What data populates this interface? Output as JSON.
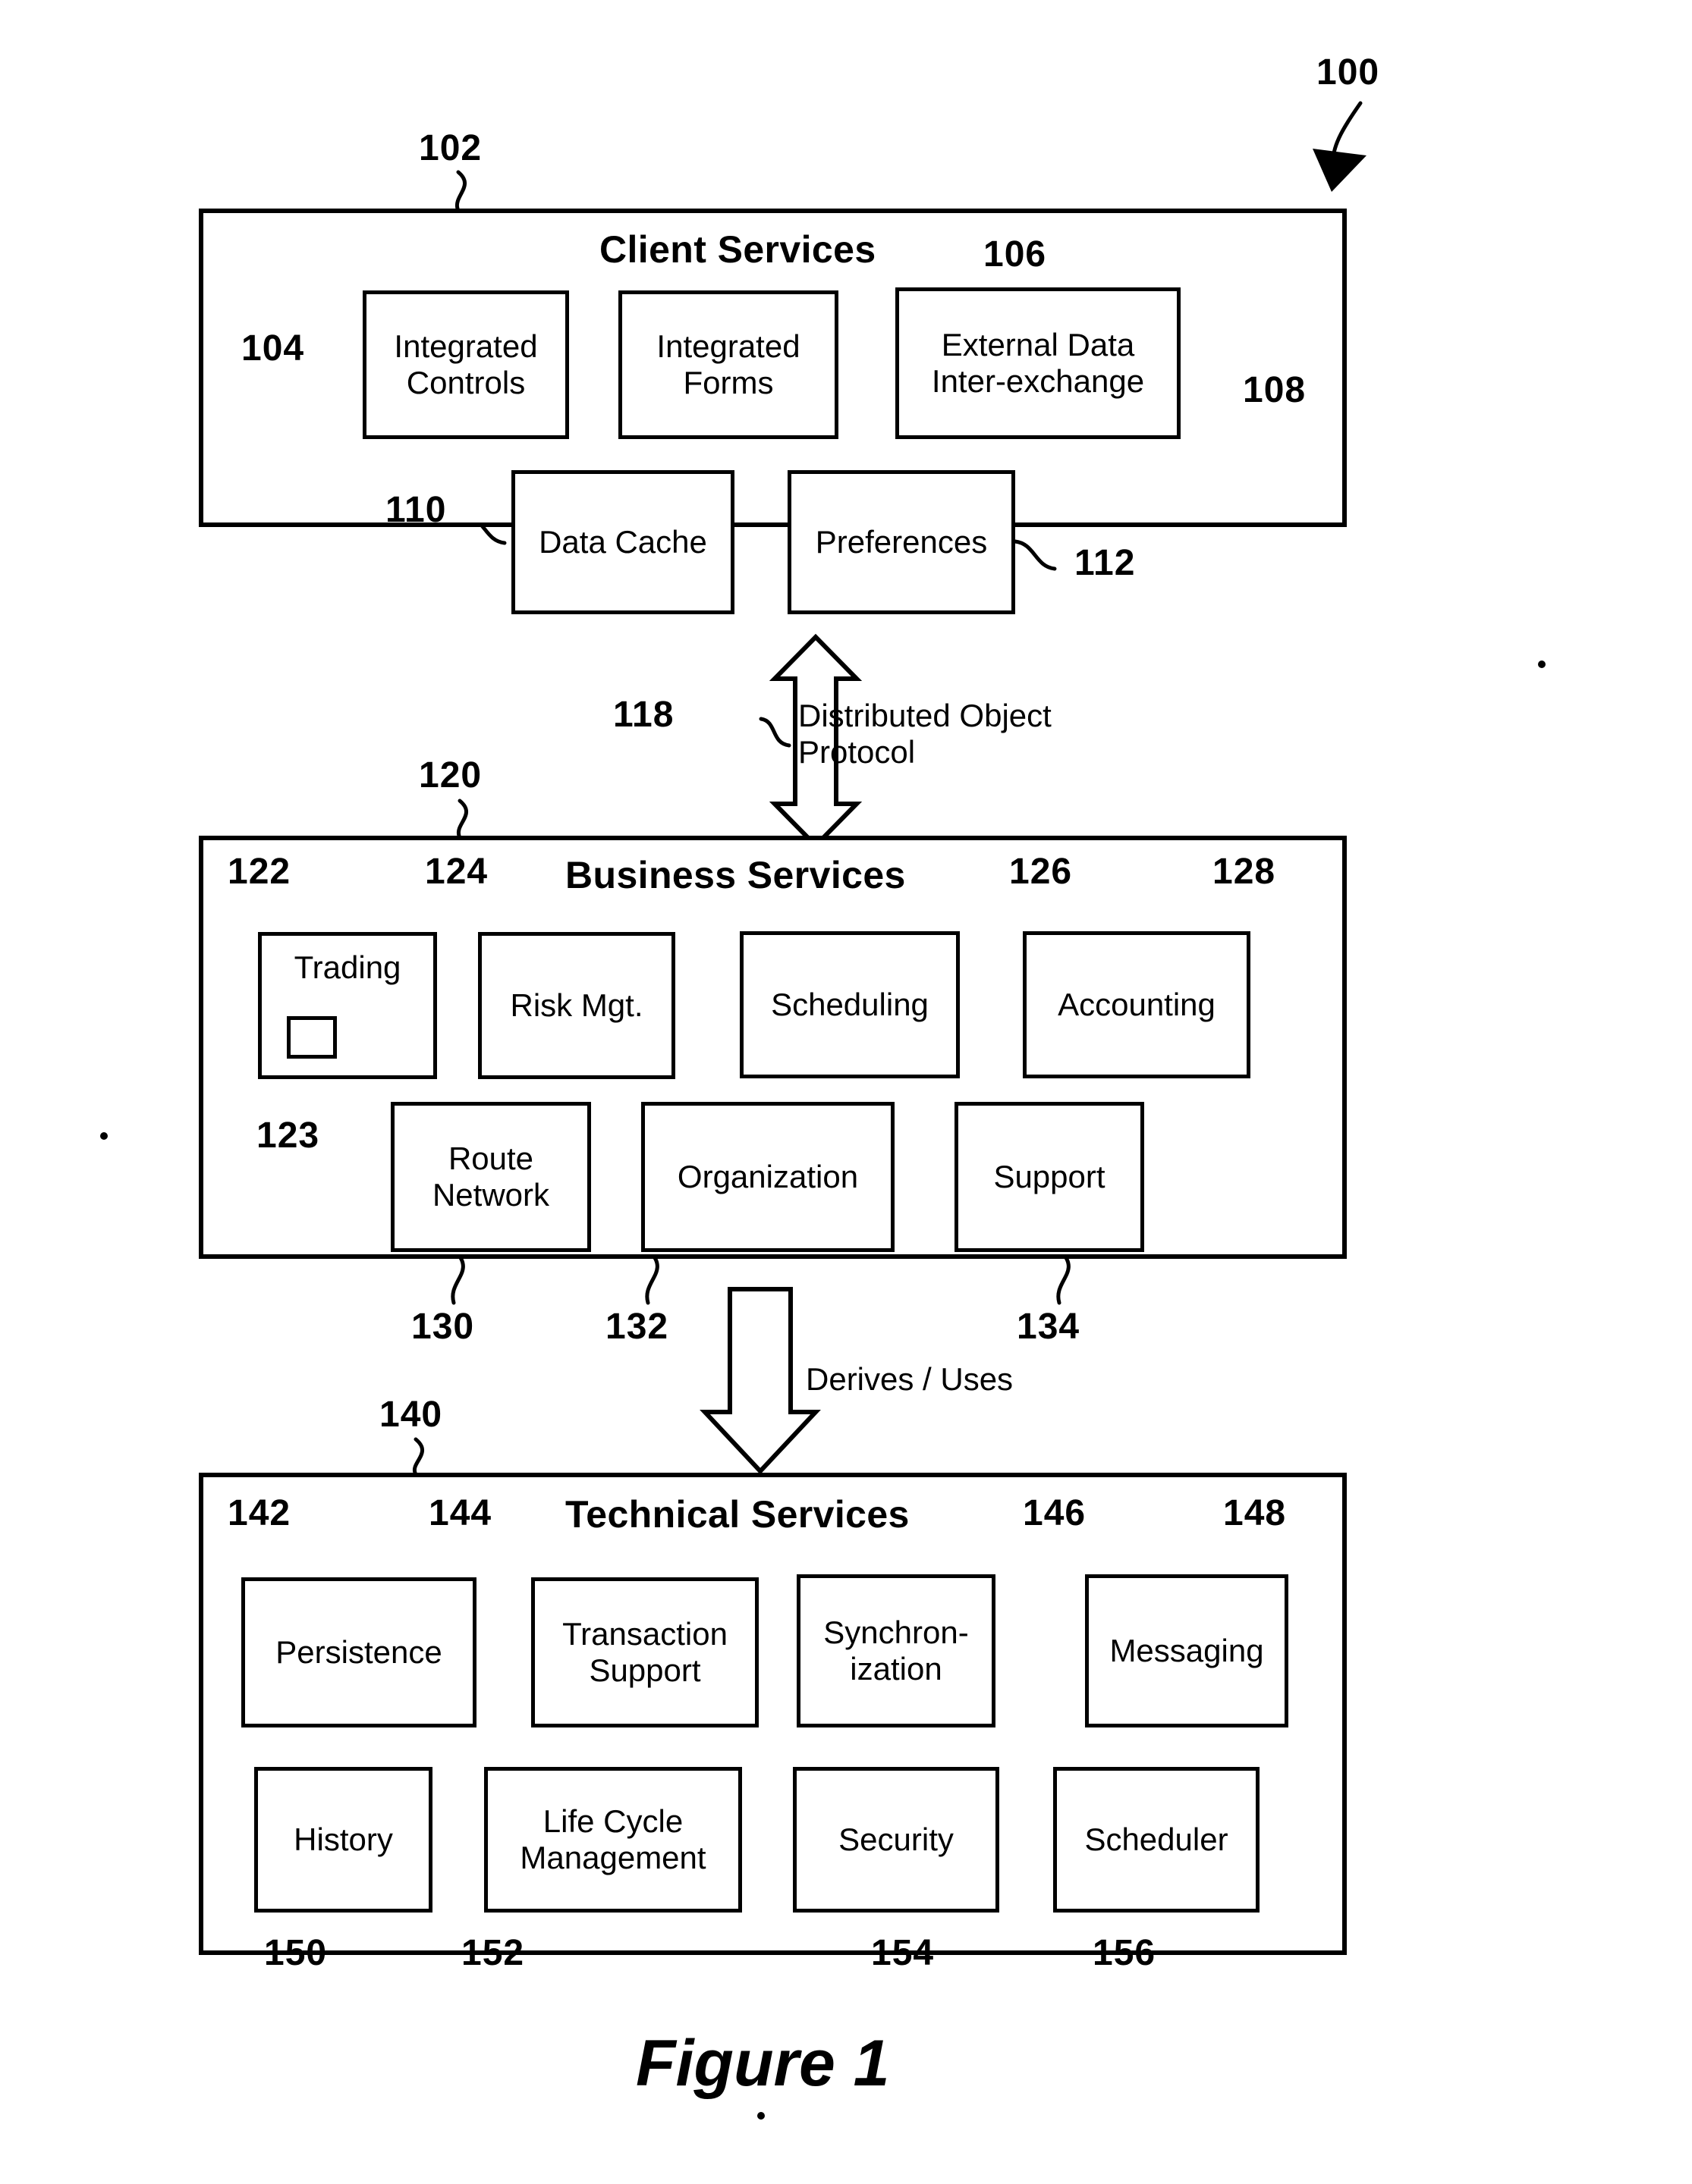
{
  "figure": {
    "caption": "Figure 1",
    "system_ref": "100"
  },
  "layers": [
    {
      "id": "client",
      "ref": "102",
      "title": "Client Services",
      "modules": [
        {
          "ref": "104",
          "label": "Integrated Controls",
          "lines": [
            "Integrated",
            "Controls"
          ]
        },
        {
          "ref": "106",
          "label": "Integrated Forms",
          "lines": [
            "Integrated",
            "Forms"
          ]
        },
        {
          "ref": "108",
          "label": "External Data Inter-exchange",
          "lines": [
            "External Data",
            "Inter-exchange"
          ]
        },
        {
          "ref": "110",
          "label": "Data Cache",
          "lines": [
            "Data Cache"
          ]
        },
        {
          "ref": "112",
          "label": "Preferences",
          "lines": [
            "Preferences"
          ]
        }
      ]
    },
    {
      "id": "business",
      "ref": "120",
      "title": "Business Services",
      "modules": [
        {
          "ref": "122",
          "label": "Trading",
          "lines": [
            "Trading"
          ],
          "sub_ref": "123"
        },
        {
          "ref": "124",
          "label": "Risk Mgt.",
          "lines": [
            "Risk Mgt."
          ]
        },
        {
          "ref": "126",
          "label": "Scheduling",
          "lines": [
            "Scheduling"
          ]
        },
        {
          "ref": "128",
          "label": "Accounting",
          "lines": [
            "Accounting"
          ]
        },
        {
          "ref": "130",
          "label": "Route Network",
          "lines": [
            "Route",
            "Network"
          ]
        },
        {
          "ref": "132",
          "label": "Organization",
          "lines": [
            "Organization"
          ]
        },
        {
          "ref": "134",
          "label": "Support",
          "lines": [
            "Support"
          ]
        }
      ]
    },
    {
      "id": "technical",
      "ref": "140",
      "title": "Technical Services",
      "modules": [
        {
          "ref": "142",
          "label": "Persistence",
          "lines": [
            "Persistence"
          ]
        },
        {
          "ref": "144",
          "label": "Transaction Support",
          "lines": [
            "Transaction",
            "Support"
          ]
        },
        {
          "ref": "146",
          "label": "Synchronization",
          "lines": [
            "Synchron-",
            "ization"
          ]
        },
        {
          "ref": "148",
          "label": "Messaging",
          "lines": [
            "Messaging"
          ]
        },
        {
          "ref": "150",
          "label": "History",
          "lines": [
            "History"
          ]
        },
        {
          "ref": "152",
          "label": "Life Cycle Management",
          "lines": [
            "Life Cycle",
            "Management"
          ]
        },
        {
          "ref": "154",
          "label": "Security",
          "lines": [
            "Security"
          ]
        },
        {
          "ref": "156",
          "label": "Scheduler",
          "lines": [
            "Scheduler"
          ]
        }
      ]
    }
  ],
  "connectors": [
    {
      "id": "dop",
      "ref": "118",
      "label_line1": "Distributed Object",
      "label_line2": "Protocol",
      "kind": "double-headed-block-arrow"
    },
    {
      "id": "derives",
      "ref": "",
      "label_line1": "Derives / Uses",
      "label_line2": "",
      "kind": "down-block-arrow"
    }
  ],
  "colors": {
    "ink": "#000000",
    "paper": "#ffffff"
  }
}
